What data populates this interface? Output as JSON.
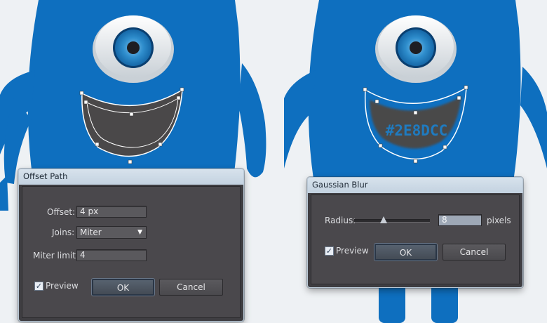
{
  "colors": {
    "monster": "#0e6fbf",
    "eye_iris": "#2e8dcc",
    "mouth": "#4a4849",
    "dialog_bg": "#4a484c"
  },
  "mouth_label": "#2E8DCC",
  "offset_path": {
    "title": "Offset Path",
    "offset_label": "Offset:",
    "offset_value": "4 px",
    "joins_label": "Joins:",
    "joins_value": "Miter",
    "miter_label": "Miter limit:",
    "miter_value": "4",
    "preview_label": "Preview",
    "preview_checked": true,
    "ok_label": "OK",
    "cancel_label": "Cancel"
  },
  "gaussian_blur": {
    "title": "Gaussian Blur",
    "radius_label": "Radius:",
    "radius_value": "8",
    "radius_unit": "pixels",
    "preview_label": "Preview",
    "preview_checked": true,
    "ok_label": "OK",
    "cancel_label": "Cancel"
  }
}
